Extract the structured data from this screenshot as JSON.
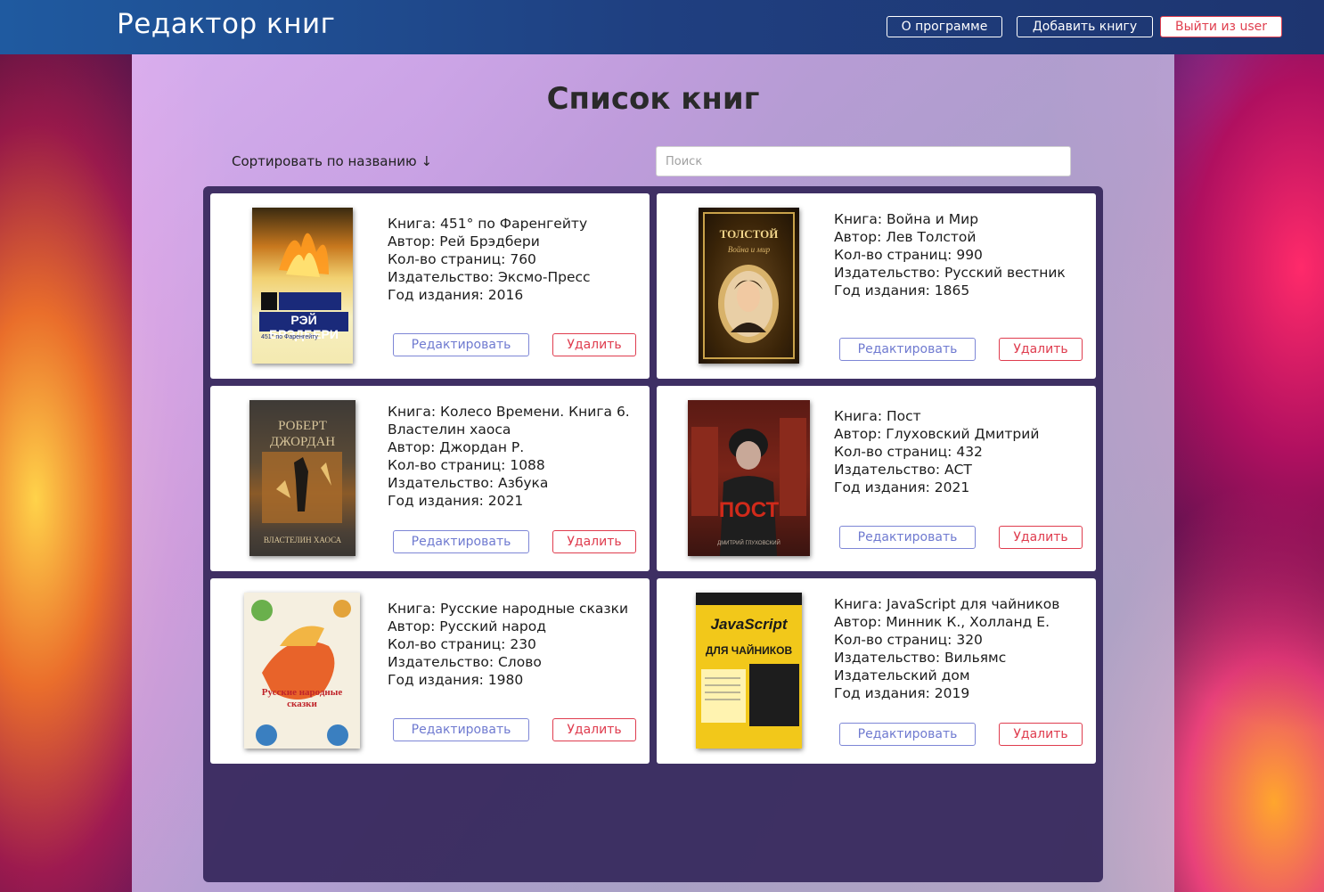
{
  "header": {
    "brand": "Редактор книг",
    "about_label": "О программе",
    "add_label": "Добавить книгу",
    "logout_label": "Выйти из user"
  },
  "main": {
    "title": "Список книг",
    "sort_label": "Сортировать по  названию ↓",
    "search_placeholder": "Поиск"
  },
  "books": [
    {
      "line1": "Книга: 451° по Фаренгейту",
      "line2": "Автор: Рей Брэдбери",
      "line3": "Кол-во страниц: 760",
      "line4": "Издательство: Эксмо-Пресс",
      "line5": "Год издания: 2016",
      "cover_text": "РЭЙ БРЭДБЕРИ",
      "cover_sub": "451° по Фаренгейту",
      "edit_label": "Редактировать",
      "delete_label": "Удалить"
    },
    {
      "line1": "Книга: Война и Мир",
      "line2": "Автор: Лев Толстой",
      "line3": "Кол-во страниц: 990",
      "line4": "Издательство: Русский вестник",
      "line5": "Год издания: 1865",
      "cover_text": "ТОЛСТОЙ",
      "cover_sub": "Война и мир",
      "edit_label": "Редактировать",
      "delete_label": "Удалить"
    },
    {
      "line1": "Книга: Колесо Времени. Книга 6. Властелин хаоса",
      "line2": "Автор: Джордан Р.",
      "line3": "Кол-во страниц: 1088",
      "line4": "Издательство: Азбука",
      "line5": "Год издания: 2021",
      "cover_text": "РОБЕРТ ДЖОРДАН",
      "cover_sub": "ВЛАСТЕЛИН ХАОСА",
      "edit_label": "Редактировать",
      "delete_label": "Удалить"
    },
    {
      "line1": "Книга: Пост",
      "line2": "Автор: Глуховский Дмитрий",
      "line3": "Кол-во страниц: 432",
      "line4": "Издательство: АСТ",
      "line5": "Год издания: 2021",
      "cover_text": "ПОСТ",
      "cover_sub": "ДМИТРИЙ ГЛУХОВСКИЙ",
      "edit_label": "Редактировать",
      "delete_label": "Удалить"
    },
    {
      "line1": "Книга: Русские народные сказки",
      "line2": "Автор: Русский народ",
      "line3": "Кол-во страниц: 230",
      "line4": "Издательство: Слово",
      "line5": "Год издания: 1980",
      "cover_text": "Русские народные сказки",
      "cover_sub": "",
      "edit_label": "Редактировать",
      "delete_label": "Удалить"
    },
    {
      "line1": "Книга: JavaScript для чайников",
      "line2": "Автор: Минник К., Холланд Е.",
      "line3": "Кол-во страниц: 320",
      "line4": "Издательство: Вильямс Издательский дом",
      "line5": "Год издания: 2019",
      "cover_text": "JavaScript",
      "cover_sub": "ДЛЯ ЧАЙНИКОВ",
      "edit_label": "Редактировать",
      "delete_label": "Удалить"
    }
  ]
}
